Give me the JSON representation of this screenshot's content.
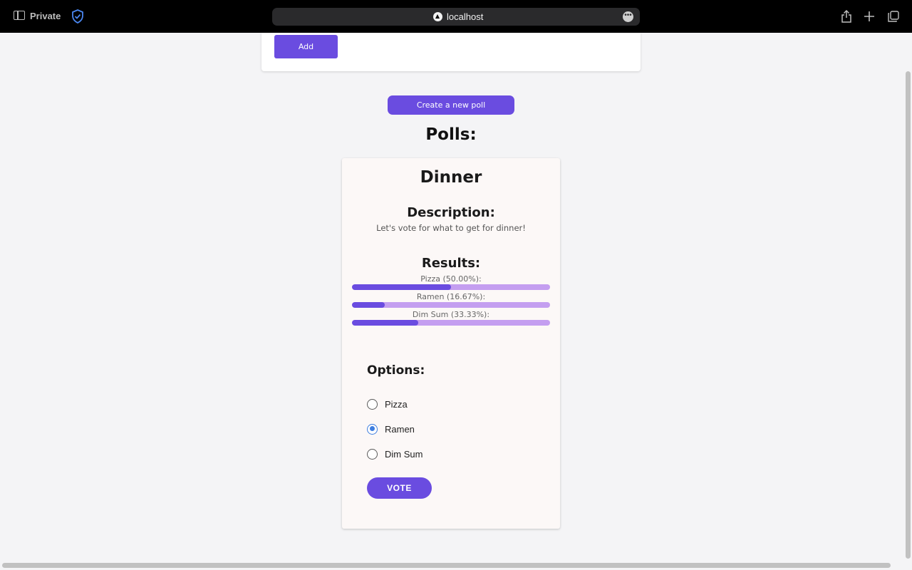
{
  "browser": {
    "mode_label": "Private",
    "url": "localhost",
    "icons": [
      "sidebar-icon",
      "shield-icon",
      "site-icon",
      "more-icon",
      "share-icon",
      "new-tab-icon",
      "tabs-icon"
    ]
  },
  "top_card": {
    "add_label": "Add"
  },
  "create_poll_label": "Create a new poll",
  "polls_heading": "Polls:",
  "poll": {
    "title": "Dinner",
    "description_heading": "Description:",
    "description": "Let's vote for what to get for dinner!",
    "results_heading": "Results:",
    "results": [
      {
        "label": "Pizza (50.00%):",
        "percent": 50.0
      },
      {
        "label": "Ramen (16.67%):",
        "percent": 16.67
      },
      {
        "label": "Dim Sum (33.33%):",
        "percent": 33.33
      }
    ],
    "options_heading": "Options:",
    "options": [
      {
        "label": "Pizza",
        "checked": false
      },
      {
        "label": "Ramen",
        "checked": true
      },
      {
        "label": "Dim Sum",
        "checked": false
      }
    ],
    "vote_label": "VOTE"
  },
  "colors": {
    "accent": "#6a4ce0",
    "bar_track": "#c49ef0",
    "radio_checked": "#3e7ee0",
    "card_bg": "#fcf8f7"
  }
}
